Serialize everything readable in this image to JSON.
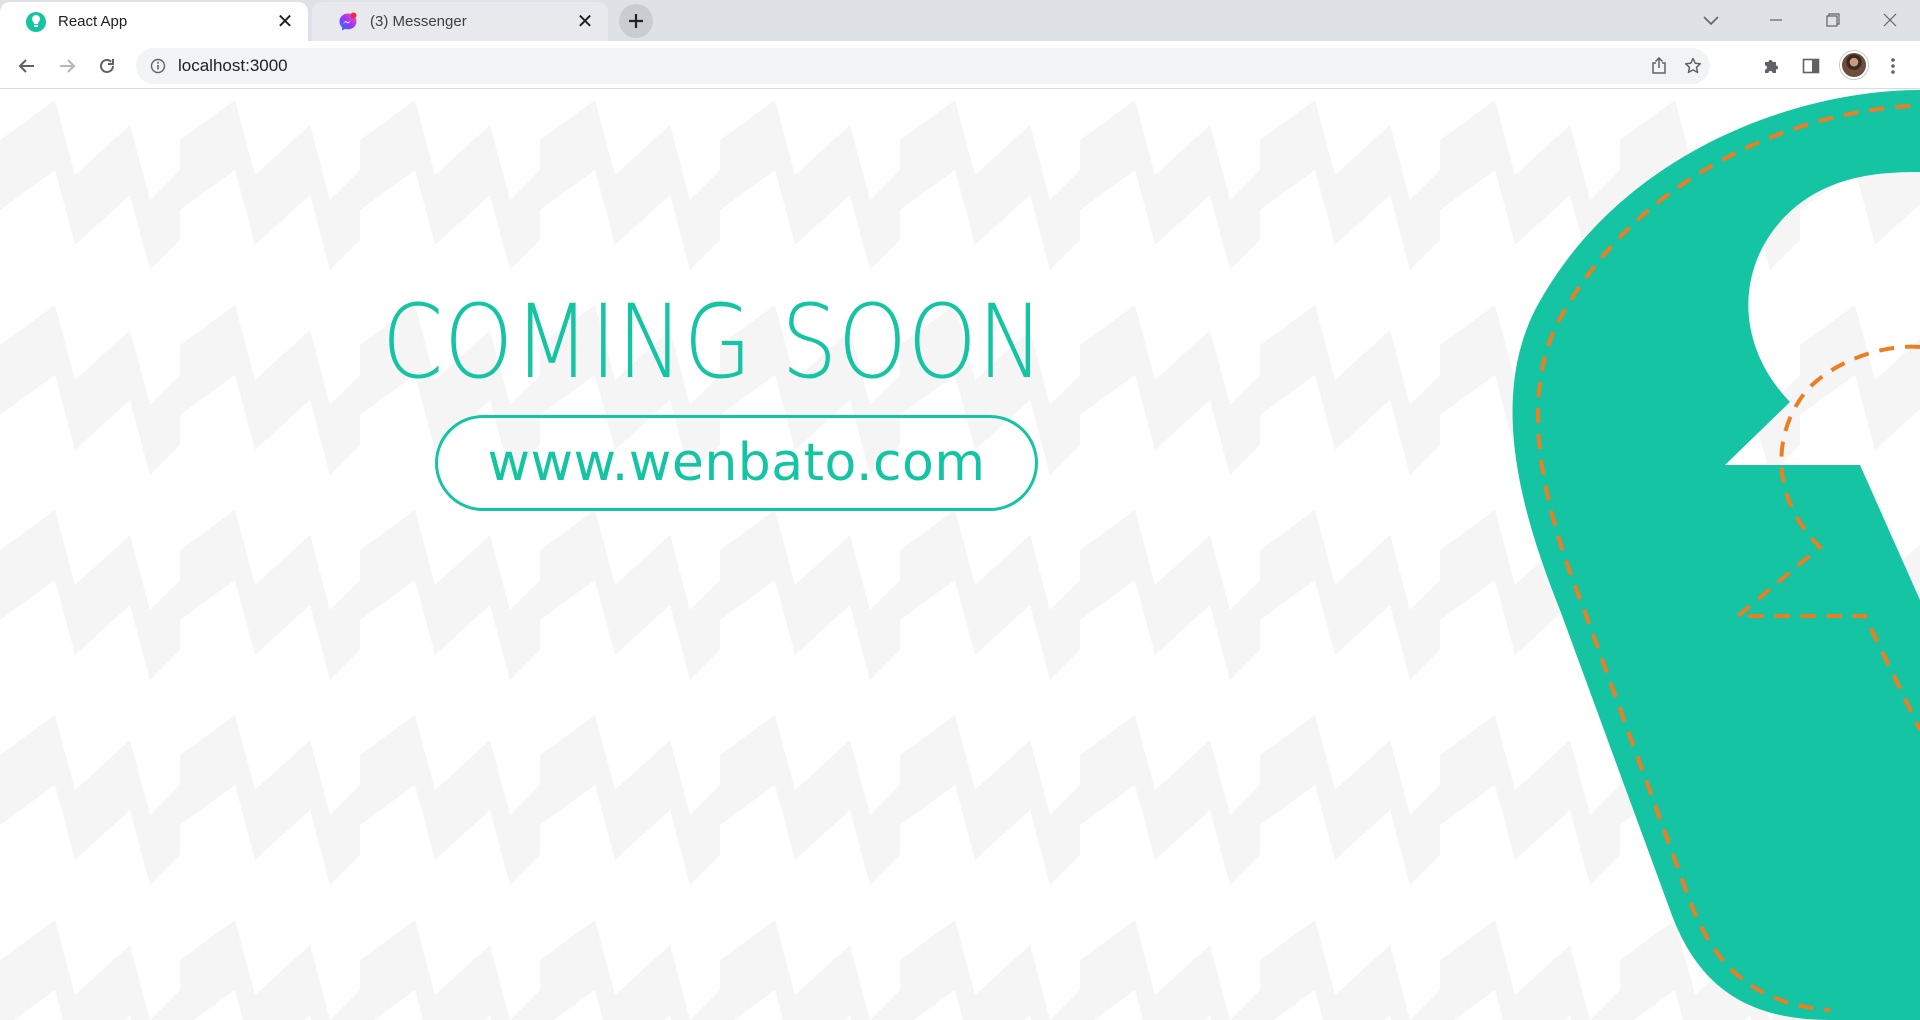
{
  "browser": {
    "tabs": [
      {
        "title": "React App",
        "active": true,
        "favicon": "react-app-favicon-icon"
      },
      {
        "title": "(3) Messenger",
        "active": false,
        "favicon": "messenger-favicon-icon"
      }
    ],
    "address": "localhost:3000"
  },
  "page": {
    "headline": "COMING SOON",
    "website": "www.wenbato.com"
  },
  "colors": {
    "brand_teal": "#14c4a2",
    "dashed_stitch": "#ee7d22",
    "pattern_grey": "#f4f4f4"
  }
}
